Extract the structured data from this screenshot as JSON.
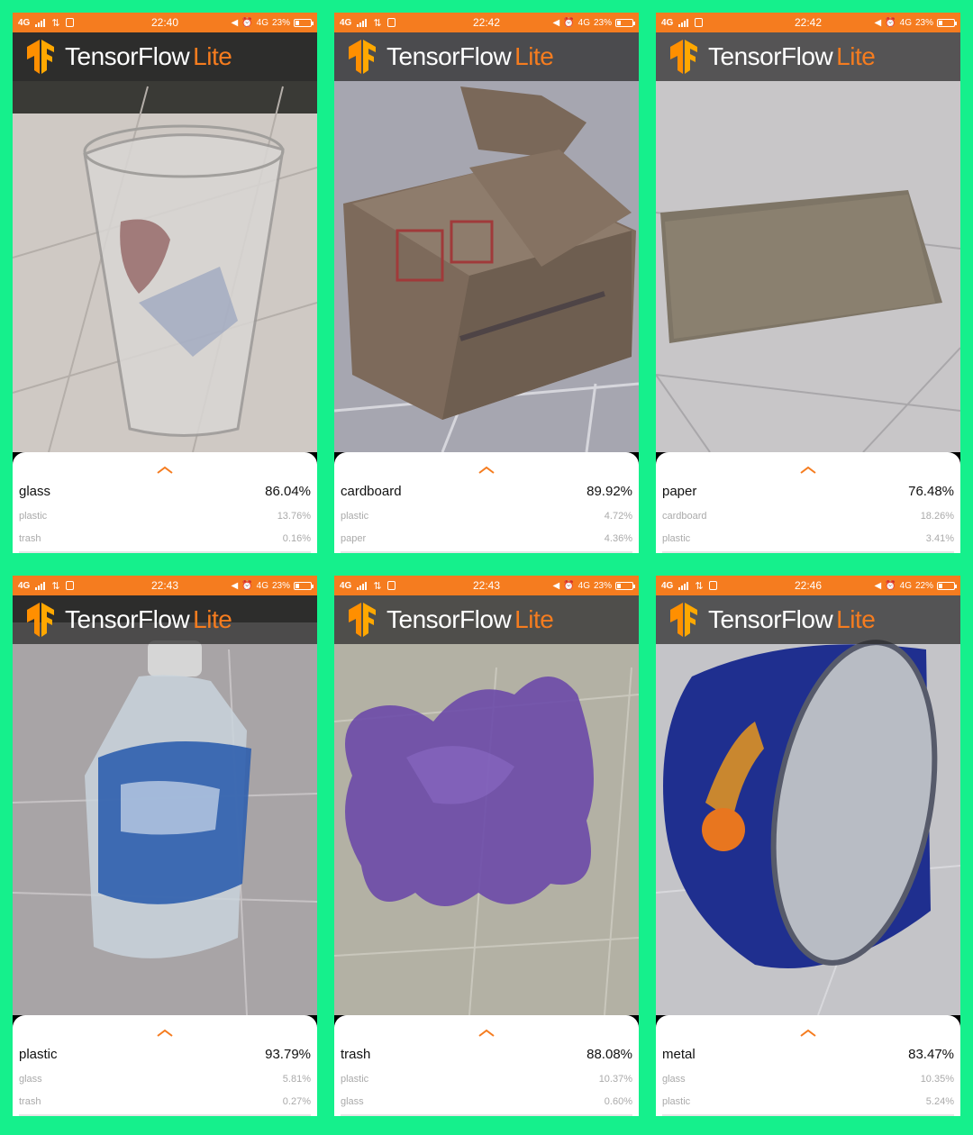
{
  "brand": {
    "main": "TensorFlow",
    "lite": "Lite"
  },
  "colors": {
    "background": "#15f08c",
    "accent": "#f57c1f"
  },
  "screens": [
    {
      "status": {
        "network": "4G",
        "time": "22:40",
        "net_right": "4G",
        "battery": "23%",
        "battery_level": 0.23
      },
      "result": {
        "top_label": "glass",
        "top_value": "86.04%",
        "second_label": "plastic",
        "second_value": "13.76%",
        "third_label": "trash",
        "third_value": "0.16%"
      }
    },
    {
      "status": {
        "network": "4G",
        "time": "22:42",
        "net_right": "4G",
        "battery": "23%",
        "battery_level": 0.23
      },
      "result": {
        "top_label": "cardboard",
        "top_value": "89.92%",
        "second_label": "plastic",
        "second_value": "4.72%",
        "third_label": "paper",
        "third_value": "4.36%"
      }
    },
    {
      "status": {
        "network": "4G",
        "time": "22:42",
        "net_right": "4G",
        "battery": "23%",
        "battery_level": 0.23
      },
      "result": {
        "top_label": "paper",
        "top_value": "76.48%",
        "second_label": "cardboard",
        "second_value": "18.26%",
        "third_label": "plastic",
        "third_value": "3.41%"
      }
    },
    {
      "status": {
        "network": "4G",
        "time": "22:43",
        "net_right": "4G",
        "battery": "23%",
        "battery_level": 0.23
      },
      "result": {
        "top_label": "plastic",
        "top_value": "93.79%",
        "second_label": "glass",
        "second_value": "5.81%",
        "third_label": "trash",
        "third_value": "0.27%"
      }
    },
    {
      "status": {
        "network": "4G",
        "time": "22:43",
        "net_right": "4G",
        "battery": "23%",
        "battery_level": 0.23
      },
      "result": {
        "top_label": "trash",
        "top_value": "88.08%",
        "second_label": "plastic",
        "second_value": "10.37%",
        "third_label": "glass",
        "third_value": "0.60%"
      }
    },
    {
      "status": {
        "network": "4G",
        "time": "22:46",
        "net_right": "4G",
        "battery": "22%",
        "battery_level": 0.22
      },
      "result": {
        "top_label": "metal",
        "top_value": "83.47%",
        "second_label": "glass",
        "second_value": "10.35%",
        "third_label": "plastic",
        "third_value": "5.24%"
      }
    }
  ]
}
